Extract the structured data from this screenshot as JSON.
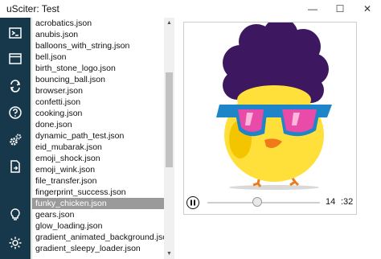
{
  "window": {
    "title": "uSciter: Test",
    "minimize_glyph": "—",
    "maximize_glyph": "☐",
    "close_glyph": "✕"
  },
  "sidebar": {
    "color": "#16384a",
    "items": [
      {
        "name": "terminal-icon"
      },
      {
        "name": "window-icon"
      },
      {
        "name": "refresh-icon"
      },
      {
        "name": "help-icon"
      },
      {
        "name": "settings-icon"
      },
      {
        "name": "file-export-icon"
      },
      {
        "name": "lightbulb-icon"
      },
      {
        "name": "sun-icon"
      }
    ]
  },
  "files": [
    "acrobatics.json",
    "anubis.json",
    "balloons_with_string.json",
    "bell.json",
    "birth_stone_logo.json",
    "bouncing_ball.json",
    "browser.json",
    "confetti.json",
    "cooking.json",
    "done.json",
    "dynamic_path_test.json",
    "eid_mubarak.json",
    "emoji_shock.json",
    "emoji_wink.json",
    "file_transfer.json",
    "fingerprint_success.json",
    "funky_chicken.json",
    "gears.json",
    "glow_loading.json",
    "gradient_animated_background.json",
    "gradient_sleepy_loader.json"
  ],
  "selected_index": 16,
  "scroll": {
    "up_glyph": "▲",
    "down_glyph": "▼"
  },
  "player": {
    "frame": "14",
    "total": ":32",
    "progress": 0.44
  },
  "colors": {
    "hair": "#3d1860",
    "body": "#ffe03a",
    "glasses_frame": "#1e86c8",
    "lens": "#e94ba8",
    "beak": "#f07a1a"
  }
}
